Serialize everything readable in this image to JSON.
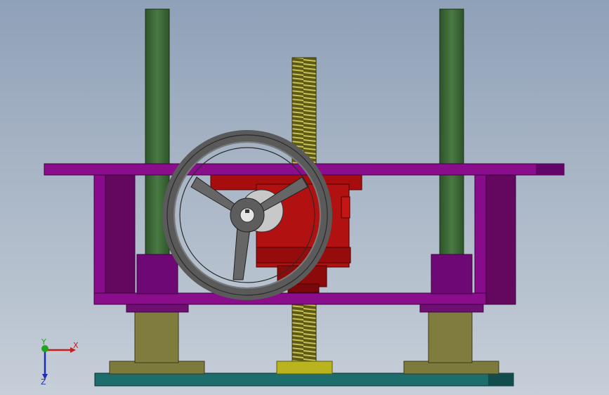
{
  "view": {
    "background": "#a7b4c5"
  },
  "triad": {
    "x_label": "X",
    "y_label": "Y",
    "z_label": "Z",
    "x_color": "#c41e1e",
    "y_color": "#1fa51f",
    "z_color": "#1b2fb0"
  },
  "colors": {
    "frame": "#8a0a8a",
    "frame_dark": "#5b0560",
    "guide_rod": "#3f6b3a",
    "lead_screw": "#6d6a1e",
    "handwheel": "#6b6b6b",
    "gearbox": "#b01010",
    "base_plate": "#1f6a6a",
    "bushing": "#7d7a3f"
  }
}
